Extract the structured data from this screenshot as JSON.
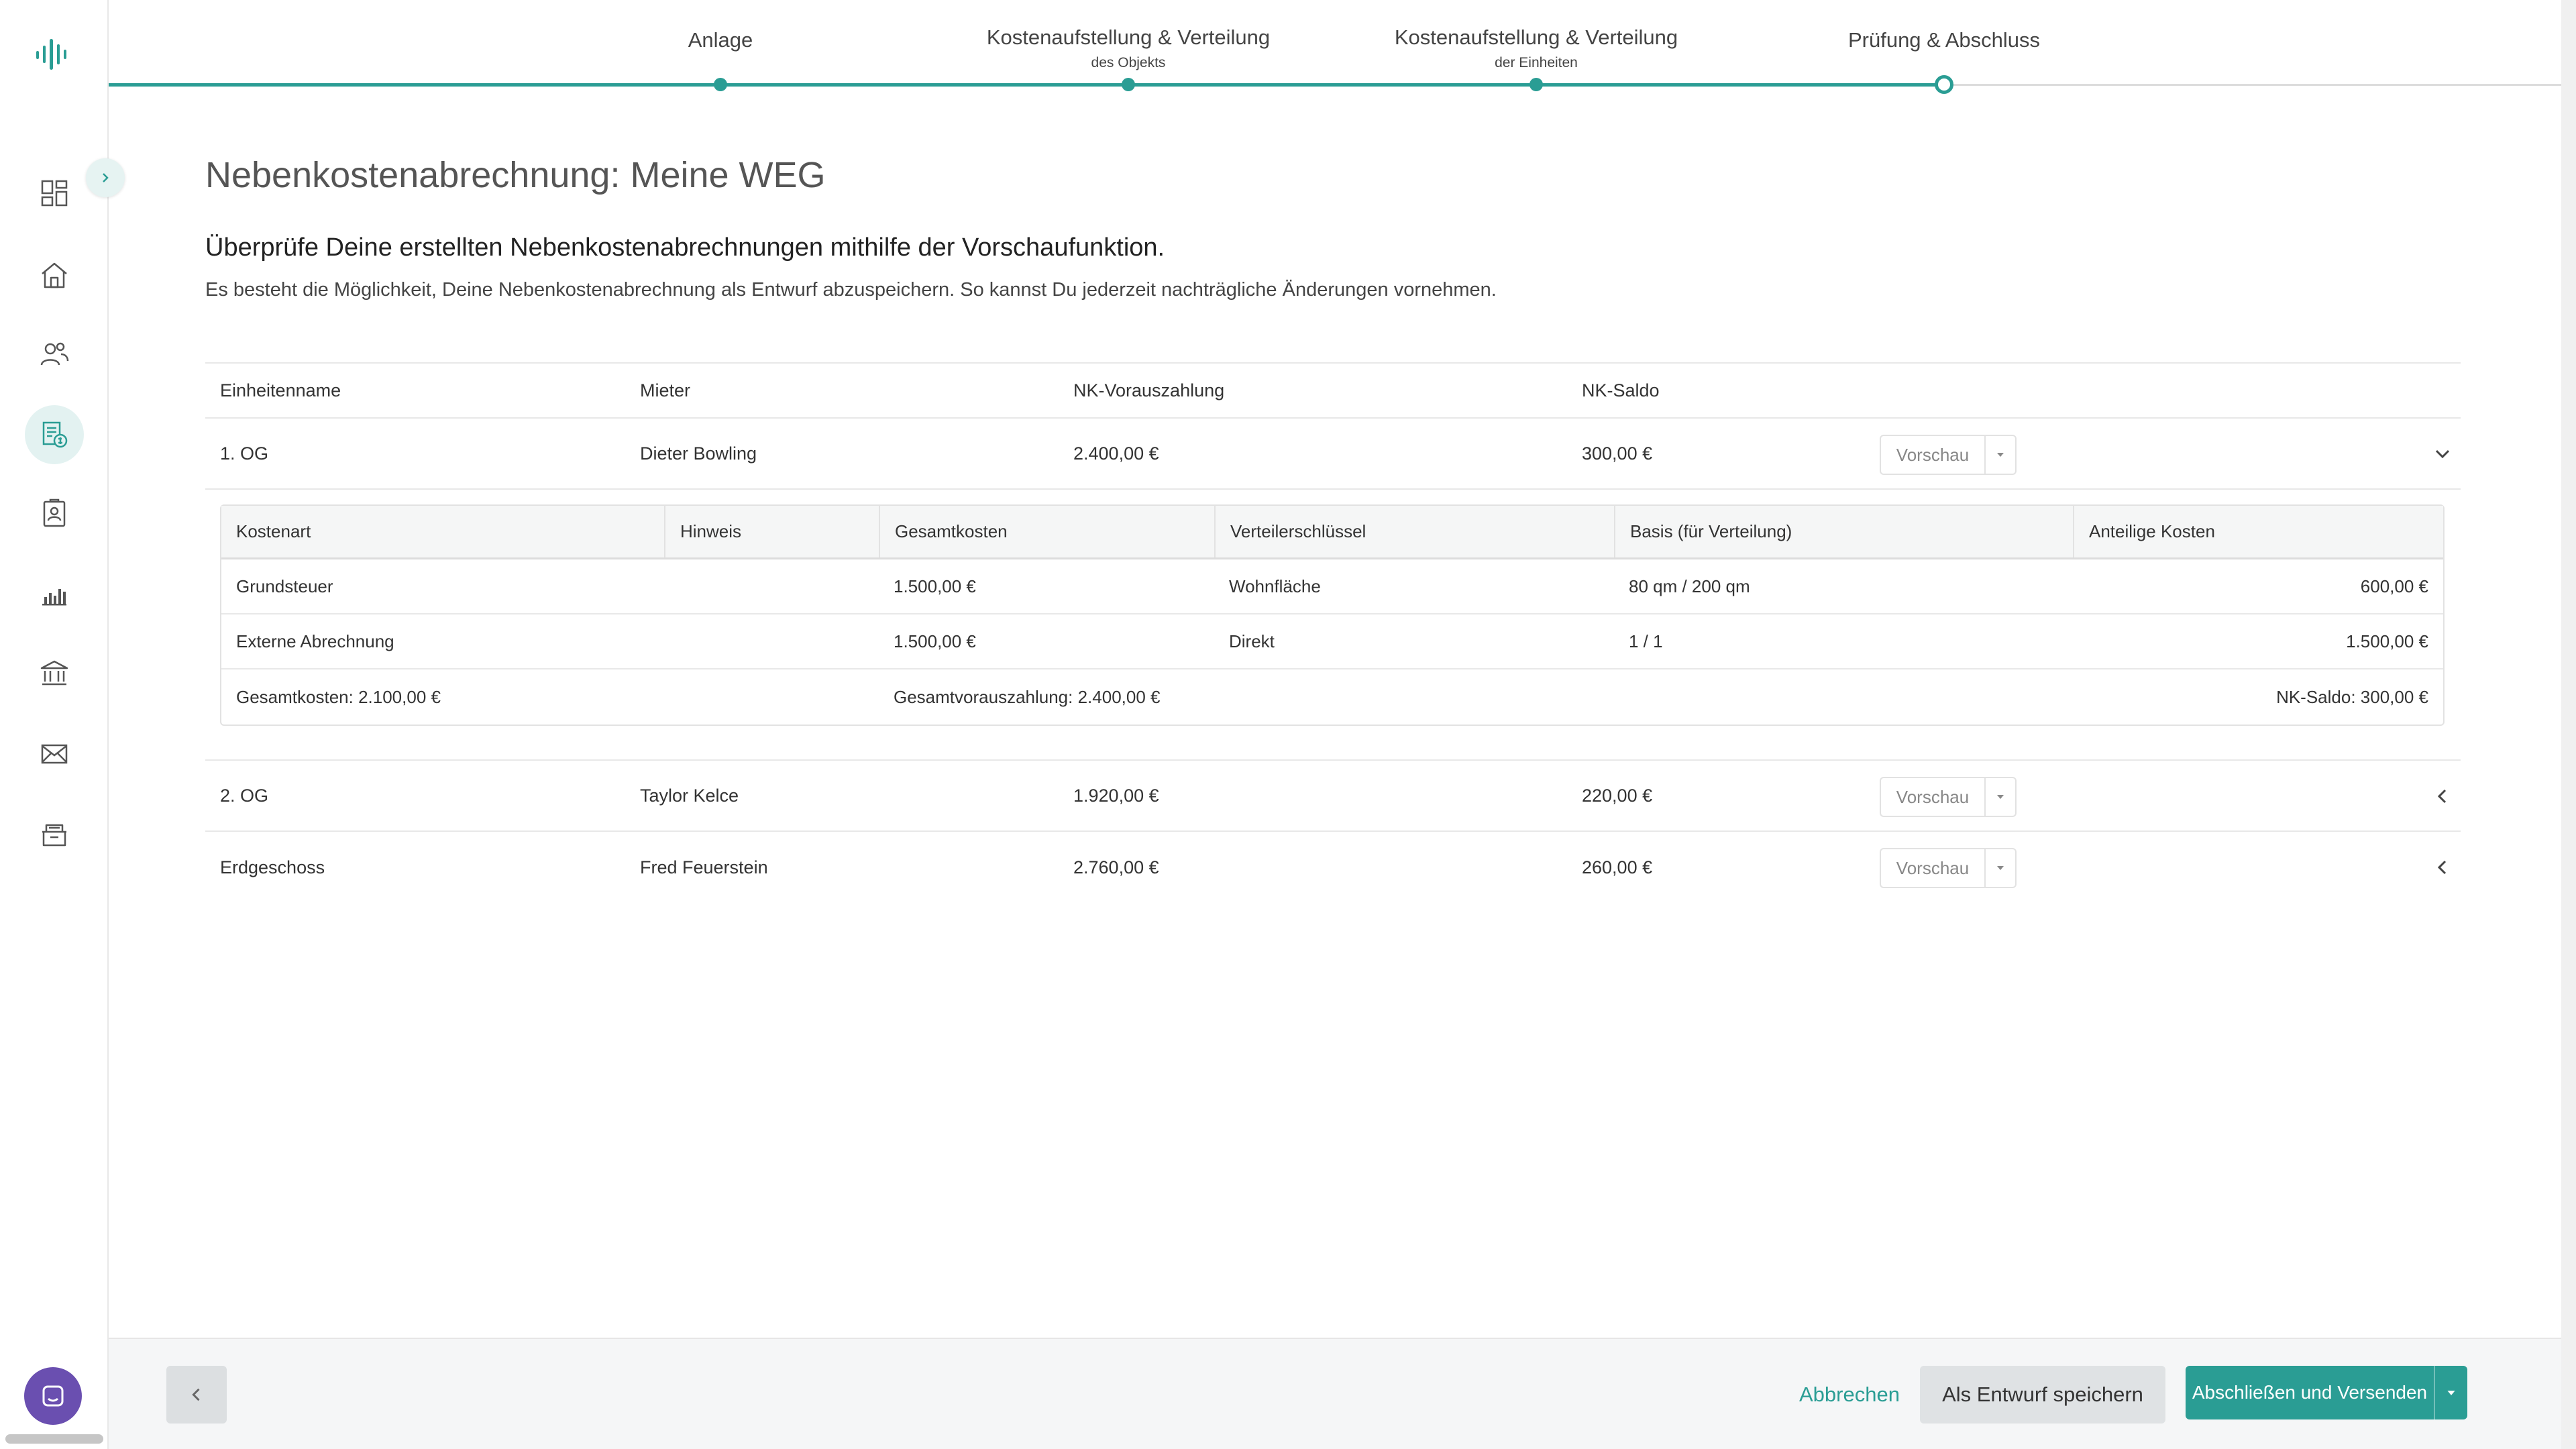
{
  "colors": {
    "accent": "#2a9d94",
    "chat": "#6a4fb0"
  },
  "sidebar": {
    "items": [
      {
        "icon": "dashboard-icon"
      },
      {
        "icon": "home-icon"
      },
      {
        "icon": "contacts-icon"
      },
      {
        "icon": "billing-icon",
        "active": true
      },
      {
        "icon": "tenant-card-icon"
      },
      {
        "icon": "chart-icon"
      },
      {
        "icon": "bank-icon"
      },
      {
        "icon": "mail-icon"
      },
      {
        "icon": "archive-icon"
      }
    ]
  },
  "stepper": {
    "steps": [
      {
        "title": "Anlage",
        "sub": ""
      },
      {
        "title": "Kostenaufstellung & Verteilung",
        "sub": "des Objekts"
      },
      {
        "title": "Kostenaufstellung & Verteilung",
        "sub": "der Einheiten"
      },
      {
        "title": "Prüfung & Abschluss",
        "sub": ""
      }
    ],
    "current_step": 4
  },
  "page": {
    "title": "Nebenkostenabrechnung: Meine WEG",
    "headline": "Überprüfe Deine erstellten Nebenkostenabrechnungen mithilfe der Vorschaufunktion.",
    "subline": "Es besteht die Möglichkeit, Deine Nebenkostenabrechnung als Entwurf abzuspeichern. So kannst Du jederzeit nachträgliche Änderungen vornehmen."
  },
  "table": {
    "headers": {
      "unit": "Einheitenname",
      "tenant": "Mieter",
      "prepayment": "NK-Vorauszahlung",
      "balance": "NK-Saldo"
    },
    "preview_label": "Vorschau",
    "rows": [
      {
        "unit": "1. OG",
        "tenant": "Dieter Bowling",
        "prepayment": "2.400,00 €",
        "balance": "300,00 €",
        "expanded": true
      },
      {
        "unit": "2. OG",
        "tenant": "Taylor Kelce",
        "prepayment": "1.920,00 €",
        "balance": "220,00 €",
        "expanded": false
      },
      {
        "unit": "Erdgeschoss",
        "tenant": "Fred Feuerstein",
        "prepayment": "2.760,00 €",
        "balance": "260,00 €",
        "expanded": false
      }
    ],
    "detail": {
      "headers": {
        "cost_type": "Kostenart",
        "note": "Hinweis",
        "total": "Gesamtkosten",
        "key": "Verteilerschlüssel",
        "basis": "Basis (für Verteilung)",
        "share": "Anteilige Kosten"
      },
      "rows": [
        {
          "cost_type": "Grundsteuer",
          "note": "",
          "total": "1.500,00 €",
          "key": "Wohnfläche",
          "basis": "80 qm / 200 qm",
          "share": "600,00 €"
        },
        {
          "cost_type": "Externe Abrechnung",
          "note": "",
          "total": "1.500,00 €",
          "key": "Direkt",
          "basis": "1 / 1",
          "share": "1.500,00 €"
        }
      ],
      "summary": {
        "total_costs": "Gesamtkosten:  2.100,00 €",
        "total_prepayment": "Gesamtvorauszahlung:  2.400,00 €",
        "balance": "NK-Saldo:  300,00 €"
      }
    }
  },
  "footer": {
    "cancel": "Abbrechen",
    "save_draft": "Als Entwurf speichern",
    "finish": "Abschließen und Versenden"
  }
}
